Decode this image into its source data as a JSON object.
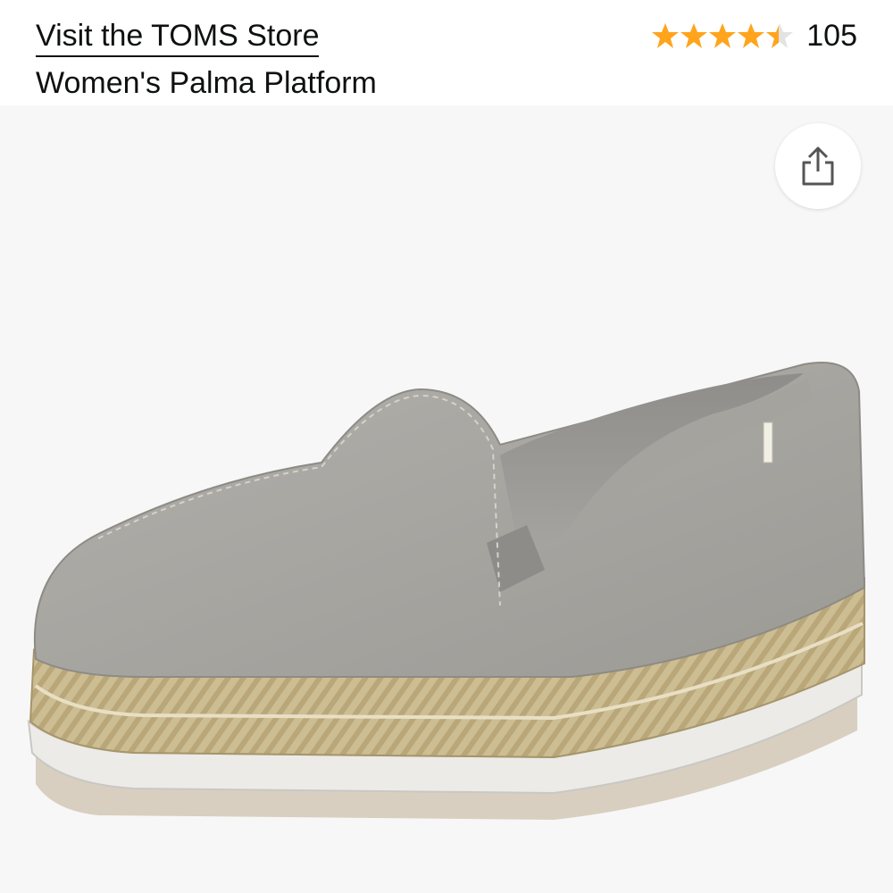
{
  "header": {
    "store_link": "Visit the TOMS Store",
    "product_title": "Women's Palma Platform",
    "rating": {
      "stars": 4.5,
      "max_stars": 5,
      "review_count": "105",
      "star_color": "#ffa41c"
    }
  },
  "image": {
    "alt": "Women's Palma Platform",
    "share_icon": "share-icon"
  },
  "colors": {
    "text": "#0f1111",
    "image_background": "#f7f7f7",
    "shoe_suede": "#a9a7a2",
    "jute": "#c9b98f"
  }
}
